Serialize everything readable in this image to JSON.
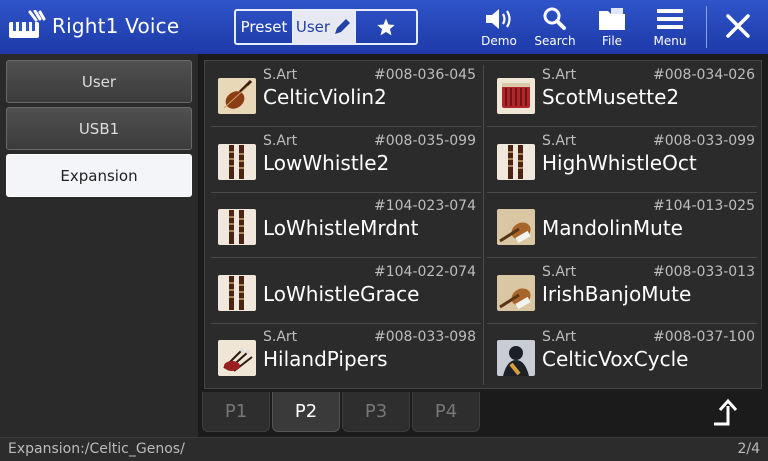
{
  "header": {
    "title": "Right1 Voice",
    "segments": {
      "preset": "Preset",
      "user": "User",
      "favorite_icon": "star-icon"
    },
    "buttons": {
      "demo": "Demo",
      "search": "Search",
      "file": "File",
      "menu": "Menu"
    },
    "accent": "#2a4bbf"
  },
  "sidebar": {
    "items": [
      "User",
      "USB1",
      "Expansion"
    ],
    "active": "Expansion"
  },
  "voices": [
    {
      "tag": "S.Art",
      "number": "#008-036-045",
      "name": "CelticViolin2",
      "icon": "violin-icon"
    },
    {
      "tag": "S.Art",
      "number": "#008-034-026",
      "name": "ScotMusette2",
      "icon": "accordion-icon"
    },
    {
      "tag": "S.Art",
      "number": "#008-035-099",
      "name": "LowWhistle2",
      "icon": "whistle-icon"
    },
    {
      "tag": "S.Art",
      "number": "#008-033-099",
      "name": "HighWhistleOct",
      "icon": "whistle-icon"
    },
    {
      "tag": "",
      "number": "#104-023-074",
      "name": "LoWhistleMrdnt",
      "icon": "whistle-icon"
    },
    {
      "tag": "",
      "number": "#104-013-025",
      "name": "MandolinMute",
      "icon": "mandolin-icon"
    },
    {
      "tag": "",
      "number": "#104-022-074",
      "name": "LoWhistleGrace",
      "icon": "whistle-icon"
    },
    {
      "tag": "S.Art",
      "number": "#008-033-013",
      "name": "IrishBanjoMute",
      "icon": "banjo-icon"
    },
    {
      "tag": "S.Art",
      "number": "#008-033-098",
      "name": "HilandPipers",
      "icon": "bagpipe-icon"
    },
    {
      "tag": "S.Art",
      "number": "#008-037-100",
      "name": "CelticVoxCycle",
      "icon": "voice-icon"
    }
  ],
  "pages": {
    "tabs": [
      "P1",
      "P2",
      "P3",
      "P4"
    ],
    "active": "P2"
  },
  "footer": {
    "path": "Expansion:/Celtic_Genos/",
    "page": "2/4"
  }
}
